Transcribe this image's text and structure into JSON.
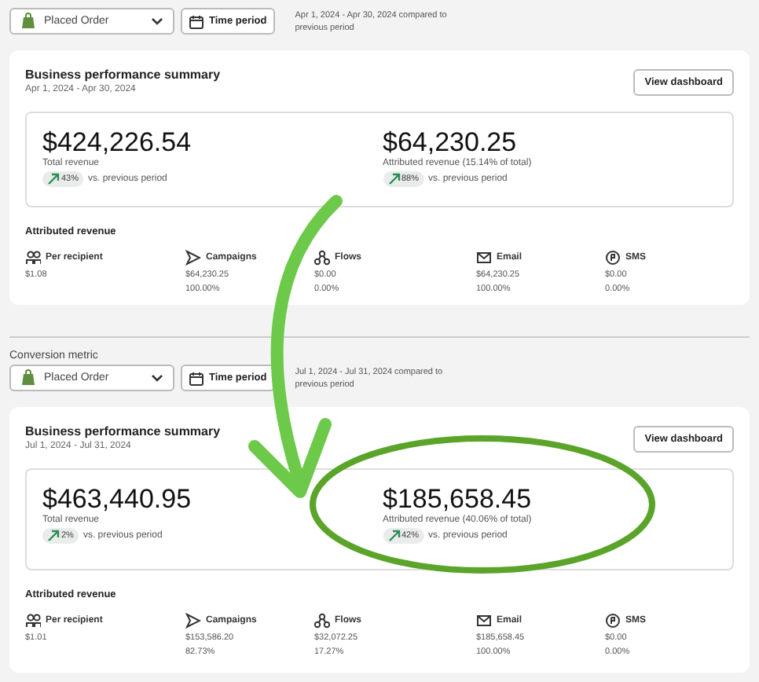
{
  "sections": [
    {
      "metric": "Placed Order",
      "time_button": "Time period",
      "range_text": "Apr 1, 2024 - Apr 30, 2024 compared to previous period",
      "card": {
        "title": "Business performance summary",
        "dates": "Apr 1, 2024 - Apr 30, 2024",
        "button": "View dashboard",
        "metrics": [
          {
            "value": "$424,226.54",
            "label": "Total revenue",
            "change": "43%",
            "change_note": "vs. previous period"
          },
          {
            "value": "$64,230.25",
            "label": "Attributed revenue (15.14% of total)",
            "change": "88%",
            "change_note": "vs. previous period"
          }
        ],
        "attributed_title": "Attributed revenue",
        "channels": [
          {
            "kind": "recipient",
            "name": "Per recipient",
            "value": "$1.08"
          },
          {
            "kind": "campaigns",
            "name": "Campaigns",
            "value": "$64,230.25",
            "share": "100.00%"
          },
          {
            "kind": "flows",
            "name": "Flows",
            "value": "$0.00",
            "share": "0.00%"
          },
          {
            "kind": "email",
            "name": "Email",
            "value": "$64,230.25",
            "share": "100.00%"
          },
          {
            "kind": "sms",
            "name": "SMS",
            "value": "$0.00",
            "share": "0.00%"
          }
        ]
      }
    },
    {
      "metric_label": "Conversion metric",
      "metric": "Placed Order",
      "time_button": "Time period",
      "range_text": "Jul 1, 2024 - Jul 31, 2024 compared to previous period",
      "card": {
        "title": "Business performance summary",
        "dates": "Jul 1, 2024 - Jul 31, 2024",
        "button": "View dashboard",
        "metrics": [
          {
            "value": "$463,440.95",
            "label": "Total revenue",
            "change": "2%",
            "change_note": "vs. previous period"
          },
          {
            "value": "$185,658.45",
            "label": "Attributed revenue (40.06% of total)",
            "change": "42%",
            "change_note": "vs. previous period"
          }
        ],
        "attributed_title": "Attributed revenue",
        "channels": [
          {
            "kind": "recipient",
            "name": "Per recipient",
            "value": "$1.01"
          },
          {
            "kind": "campaigns",
            "name": "Campaigns",
            "value": "$153,586.20",
            "share": "82.73%"
          },
          {
            "kind": "flows",
            "name": "Flows",
            "value": "$32,072.25",
            "share": "17.27%"
          },
          {
            "kind": "email",
            "name": "Email",
            "value": "$185,658.45",
            "share": "100.00%"
          },
          {
            "kind": "sms",
            "name": "SMS",
            "value": "$0.00",
            "share": "0.00%"
          }
        ]
      }
    }
  ]
}
